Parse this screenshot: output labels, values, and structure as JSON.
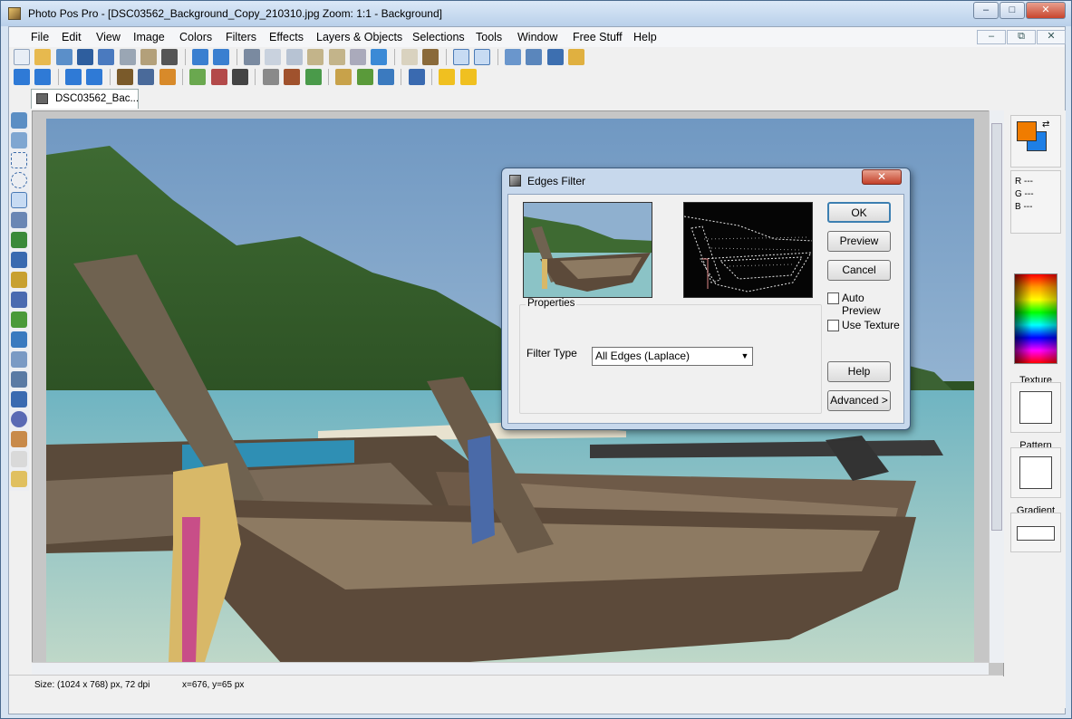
{
  "app": {
    "title": "Photo Pos Pro - [DSC03562_Background_Copy_210310.jpg  Zoom: 1:1 - Background]",
    "title_buttons": {
      "minimize": "–",
      "restore": "□",
      "close": "✕"
    },
    "mdi_buttons": {
      "minimize": "–",
      "restore": "⧉",
      "close": "✕"
    }
  },
  "menu": [
    "File",
    "Edit",
    "View",
    "Image",
    "Colors",
    "Filters",
    "Effects",
    "Layers & Objects",
    "Selections",
    "Tools",
    "Window",
    "Free Stuff",
    "Help"
  ],
  "document_tab": "DSC03562_Bac...",
  "right_panel": {
    "rgb": {
      "r": "R ---",
      "g": "G ---",
      "b": "B ---"
    },
    "texture_label": "Texture",
    "pattern_label": "Pattern",
    "gradient_label": "Gradient",
    "fg_color": "#f07c00",
    "bg_color": "#1e7fe6"
  },
  "status": {
    "size": "Size: (1024 x 768) px, 72 dpi",
    "coords": "x=676, y=65 px"
  },
  "dialog": {
    "title": "Edges Filter",
    "close": "✕",
    "ok": "OK",
    "preview": "Preview",
    "cancel": "Cancel",
    "auto_preview": "Auto Preview",
    "use_texture": "Use Texture",
    "help": "Help",
    "advanced": "Advanced >",
    "properties_legend": "Properties",
    "filter_type_label": "Filter Type",
    "filter_type_value": "All Edges (Laplace)"
  }
}
